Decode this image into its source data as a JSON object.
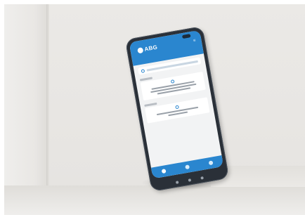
{
  "app": {
    "brand_name": "ABG",
    "header_color": "#2a86cf"
  },
  "icons": {
    "search": "search-icon",
    "card": "info-icon",
    "menu": "menu-icon",
    "nav": [
      "home-icon",
      "list-icon",
      "profile-icon"
    ],
    "soft_keys": [
      "back-icon",
      "home-key-icon",
      "recent-icon"
    ]
  }
}
